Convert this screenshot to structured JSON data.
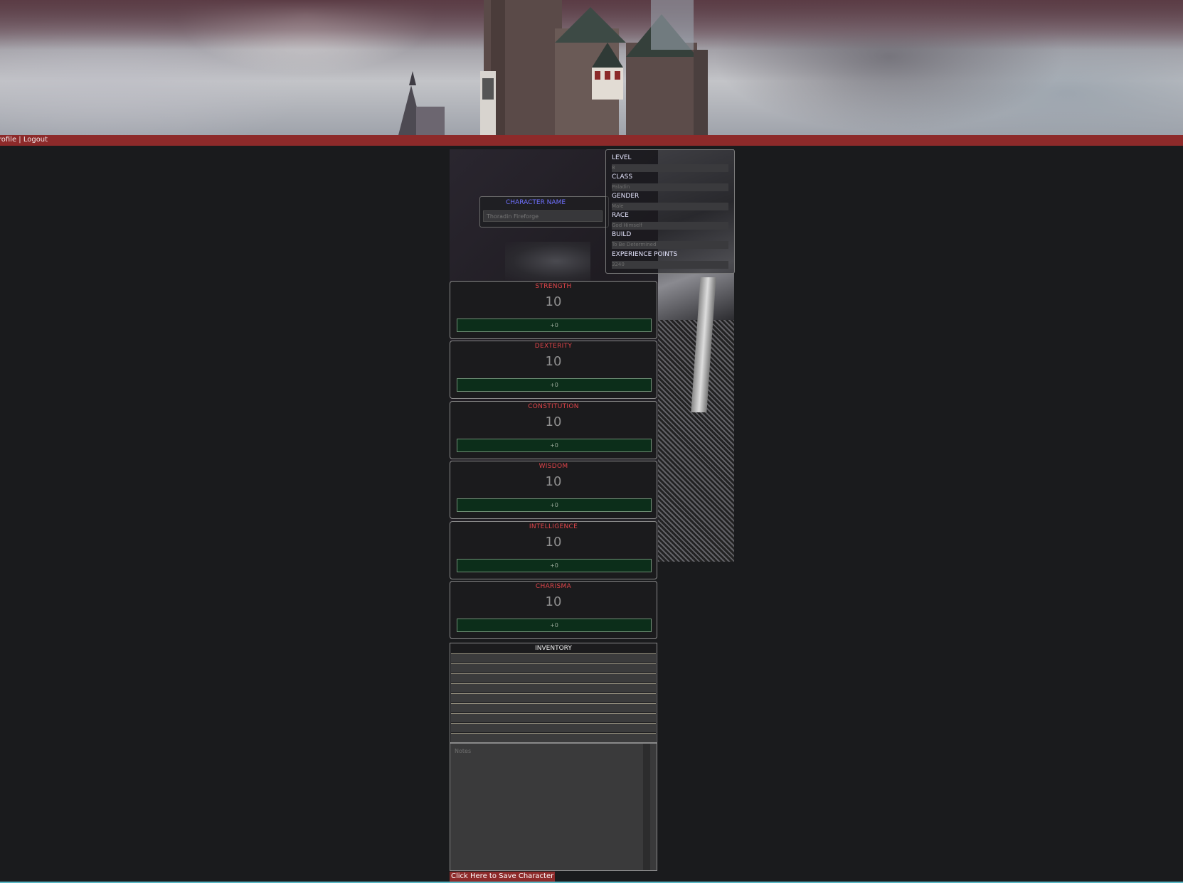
{
  "nav": {
    "profile_label": "Profile",
    "separator": " | ",
    "logout_label": "Logout"
  },
  "character": {
    "name_label": "CHARACTER NAME",
    "name_value": "Thoradin Fireforge"
  },
  "info": [
    {
      "label": "LEVEL",
      "value": "8"
    },
    {
      "label": "CLASS",
      "value": "Paladin"
    },
    {
      "label": "GENDER",
      "value": "Male"
    },
    {
      "label": "RACE",
      "value": "God Himself"
    },
    {
      "label": "BUILD",
      "value": "To Be Determined"
    },
    {
      "label": "EXPERIENCE POINTS",
      "value": "3240"
    }
  ],
  "stats": [
    {
      "name": "STRENGTH",
      "value": "10",
      "modifier": "+0"
    },
    {
      "name": "DEXTERITY",
      "value": "10",
      "modifier": "+0"
    },
    {
      "name": "CONSTITUTION",
      "value": "10",
      "modifier": "+0"
    },
    {
      "name": "WISDOM",
      "value": "10",
      "modifier": "+0"
    },
    {
      "name": "INTELLIGENCE",
      "value": "10",
      "modifier": "+0"
    },
    {
      "name": "CHARISMA",
      "value": "10",
      "modifier": "+0"
    }
  ],
  "inventory": {
    "title": "INVENTORY",
    "slots": [
      "",
      "",
      "",
      "",
      "",
      "",
      "",
      "",
      ""
    ]
  },
  "notes": {
    "placeholder": "Notes"
  },
  "save_button": "Click Here to Save Character",
  "colors": {
    "accent_red": "#8d2a2a",
    "stat_name": "#e0454a",
    "modifier_bg": "#0c2e1a",
    "name_label": "#6f70ff"
  }
}
